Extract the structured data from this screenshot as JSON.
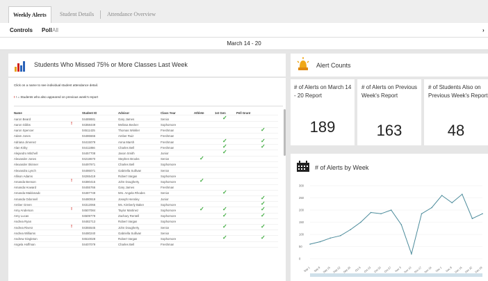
{
  "tabs": [
    {
      "label": "Weekly Alerts",
      "active": true
    },
    {
      "label": "Student Details",
      "active": false
    },
    {
      "label": "Attendance Overview",
      "active": false
    }
  ],
  "controls": {
    "label": "Controls",
    "poll_label": "Poll",
    "poll_value": "All"
  },
  "date_range": "March 14 - 20",
  "students_panel": {
    "title": "Students Who Missed 75% or More Classes Last Week",
    "instructions": "Click on a name to see individual student attendance detail.",
    "legend": "! = Students who also appeared on previous week's report",
    "columns": [
      "Name",
      "Student ID",
      "Advisor",
      "Class Year",
      "Athlete",
      "1st Gen",
      "Pell Grant"
    ],
    "rows": [
      {
        "name": "Aaron Beard",
        "id": "04489881",
        "advisor": "Gary James",
        "year": "Senior",
        "flag": false,
        "athlete": false,
        "gen": true,
        "pell": false
      },
      {
        "name": "Aaron Gibbs",
        "id": "04358449",
        "advisor": "Melissa Becker",
        "year": "Sophomore",
        "flag": true,
        "athlete": false,
        "gen": false,
        "pell": false
      },
      {
        "name": "Aaron Spencer",
        "id": "04511425",
        "advisor": "Thomas Winkler",
        "year": "Freshman",
        "flag": false,
        "athlete": false,
        "gen": false,
        "pell": true
      },
      {
        "name": "Adam Jones",
        "id": "04486666",
        "advisor": "Amber Ruiz",
        "year": "Freshman",
        "flag": false,
        "athlete": false,
        "gen": false,
        "pell": false
      },
      {
        "name": "Adriana Jimenez",
        "id": "04415079",
        "advisor": "Anna Marsh",
        "year": "Freshman",
        "flag": false,
        "athlete": false,
        "gen": true,
        "pell": true
      },
      {
        "name": "Alan Kirby",
        "id": "04411866",
        "advisor": "Charles Bell",
        "year": "Freshman",
        "flag": false,
        "athlete": false,
        "gen": true,
        "pell": true
      },
      {
        "name": "Alejandro Mitchell",
        "id": "04457708",
        "advisor": "Jason Smith",
        "year": "Junior",
        "flag": false,
        "athlete": false,
        "gen": true,
        "pell": false
      },
      {
        "name": "Alexander Jones",
        "id": "04218670",
        "advisor": "Stephen Brooks",
        "year": "Senior",
        "flag": false,
        "athlete": true,
        "gen": false,
        "pell": false
      },
      {
        "name": "Alexander Skinner",
        "id": "04497971",
        "advisor": "Charles Bell",
        "year": "Sophomore",
        "flag": false,
        "athlete": false,
        "gen": false,
        "pell": false
      },
      {
        "name": "Alexandra Lynch",
        "id": "04486071",
        "advisor": "Gabriella Sullivan",
        "year": "Senior",
        "flag": false,
        "athlete": false,
        "gen": false,
        "pell": false
      },
      {
        "name": "Allison Adams",
        "id": "04265419",
        "advisor": "Robert Vargas",
        "year": "Sophomore",
        "flag": false,
        "athlete": false,
        "gen": false,
        "pell": false
      },
      {
        "name": "Amanda Benson",
        "id": "04380415",
        "advisor": "John Dougherty",
        "year": "Sophomore",
        "flag": true,
        "athlete": true,
        "gen": false,
        "pell": false
      },
      {
        "name": "Amanda Howard",
        "id": "04455766",
        "advisor": "Gary James",
        "year": "Freshman",
        "flag": false,
        "athlete": false,
        "gen": false,
        "pell": false
      },
      {
        "name": "Amanda Maldonado",
        "id": "04487749",
        "advisor": "Mrs. Angela Rhodes",
        "year": "Senior",
        "flag": false,
        "athlete": false,
        "gen": true,
        "pell": false
      },
      {
        "name": "Amanda Odonnell",
        "id": "04480919",
        "advisor": "Joseph Hensley",
        "year": "Junior",
        "flag": false,
        "athlete": false,
        "gen": false,
        "pell": true
      },
      {
        "name": "Amber Green",
        "id": "04312066",
        "advisor": "Ms. Kimberly Baker",
        "year": "Sophomore",
        "flag": false,
        "athlete": false,
        "gen": false,
        "pell": true
      },
      {
        "name": "Amy Anderson",
        "id": "04507084",
        "advisor": "Taylor Martinez",
        "year": "Sophomore",
        "flag": true,
        "athlete": true,
        "gen": true,
        "pell": true
      },
      {
        "name": "Amy Lucas",
        "id": "04509779",
        "advisor": "Zachary Rentell",
        "year": "Sophomore",
        "flag": false,
        "athlete": false,
        "gen": true,
        "pell": true
      },
      {
        "name": "Andrea Ryan",
        "id": "04482713",
        "advisor": "Robert Vargas",
        "year": "Sophomore",
        "flag": false,
        "athlete": false,
        "gen": false,
        "pell": false
      },
      {
        "name": "Andrea Rivera",
        "id": "04355545",
        "advisor": "John Dougherty",
        "year": "Senior",
        "flag": true,
        "athlete": false,
        "gen": true,
        "pell": true
      },
      {
        "name": "Andrea Williams",
        "id": "04480240",
        "advisor": "Gabriella Sullivan",
        "year": "Senior",
        "flag": false,
        "athlete": false,
        "gen": false,
        "pell": false
      },
      {
        "name": "Andrew Singleton",
        "id": "04510028",
        "advisor": "Robert Vargas",
        "year": "Sophomore",
        "flag": false,
        "athlete": false,
        "gen": true,
        "pell": true
      },
      {
        "name": "Angela Hoffman",
        "id": "04407079",
        "advisor": "Charles Bell",
        "year": "Freshman",
        "flag": false,
        "athlete": false,
        "gen": false,
        "pell": false
      }
    ]
  },
  "alert_counts": {
    "title": "Alert Counts",
    "kpis": [
      {
        "label": "# of Alerts on March 14 - 20 Report",
        "value": "189"
      },
      {
        "label": "# of Alerts on Previous Week's Report",
        "value": "163"
      },
      {
        "label": "# of Students Also on Previous Week's Report",
        "value": "48"
      }
    ]
  },
  "alerts_by_week": {
    "title": "# of Alerts by Week"
  },
  "chart_data": {
    "type": "line",
    "title": "# of Alerts by Week",
    "y_ticks": [
      "300",
      "250",
      "200",
      "150",
      "100",
      "50",
      "0"
    ],
    "ylim": [
      0,
      300
    ],
    "x": [
      "Sep 1",
      "Sep 8",
      "Sep 15",
      "Sep 22",
      "Sep 29",
      "Oct 6",
      "Oct 13",
      "Oct 20",
      "Oct 27",
      "Nov 3",
      "Nov 10",
      "Nov 17",
      "Nov 24",
      "Dec 1",
      "Dec 8",
      "Dec 15",
      "Dec 22",
      "Dec 29"
    ],
    "values": [
      60,
      70,
      85,
      95,
      120,
      150,
      190,
      185,
      200,
      140,
      20,
      185,
      210,
      260,
      230,
      265,
      165,
      185
    ],
    "color": "#4a8a9a",
    "grid": true
  },
  "colors": {
    "accent": "#e8a318",
    "check": "#3caa3c",
    "flag": "#d0201a",
    "line": "#4a8a9a"
  }
}
